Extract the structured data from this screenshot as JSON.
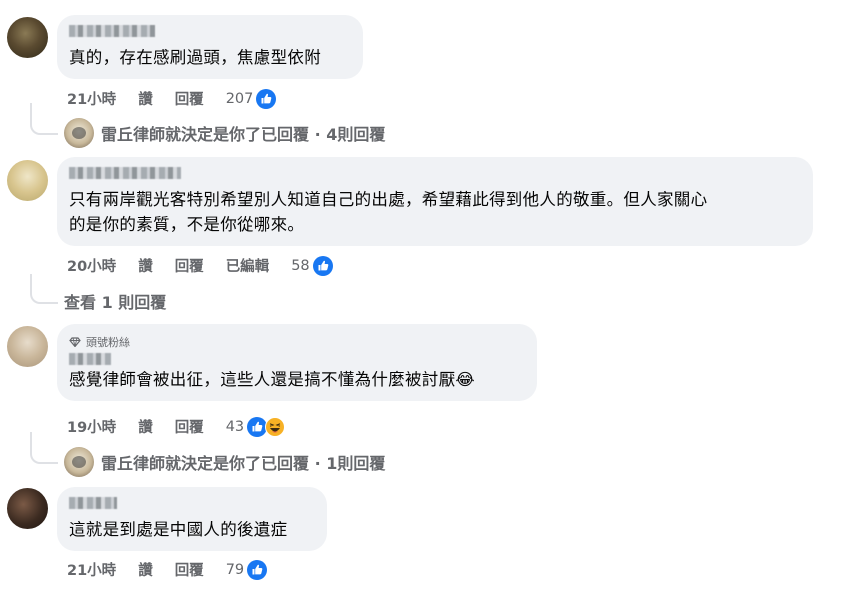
{
  "comments": [
    {
      "text": "真的，存在感刷過頭，焦慮型依附",
      "time": "21小時",
      "read_label": "讚",
      "reply_label": "回覆",
      "like_count": "207",
      "thread": {
        "replier": "雷丘律師就決定是你了",
        "summary": "已回覆 · 4則回覆"
      }
    },
    {
      "text": "只有兩岸觀光客特別希望別人知道自己的出處，希望藉此得到他人的敬重。但人家關心\n的是你的素質，不是你從哪來。",
      "time": "20小時",
      "read_label": "讚",
      "reply_label": "回覆",
      "edited_label": "已編輯",
      "like_count": "58",
      "view_replies": "查看 1 則回覆"
    },
    {
      "badge": "頭號粉絲",
      "text": "感覺律師會被出征，這些人還是搞不懂為什麼被討厭😂",
      "time": "19小時",
      "read_label": "讚",
      "reply_label": "回覆",
      "like_count": "43",
      "thread": {
        "replier": "雷丘律師就決定是你了",
        "summary": "已回覆 · 1則回覆"
      }
    },
    {
      "text": "這就是到處是中國人的後遺症",
      "time": "21小時",
      "read_label": "讚",
      "reply_label": "回覆",
      "like_count": "79"
    }
  ],
  "colors": {
    "bubble": "#f0f2f5",
    "meta_text": "#65676b",
    "like_blue": "#1877f2",
    "haha_yellow": "#f7b125"
  },
  "icons": [
    "like-icon",
    "haha-icon",
    "diamond-icon"
  ]
}
